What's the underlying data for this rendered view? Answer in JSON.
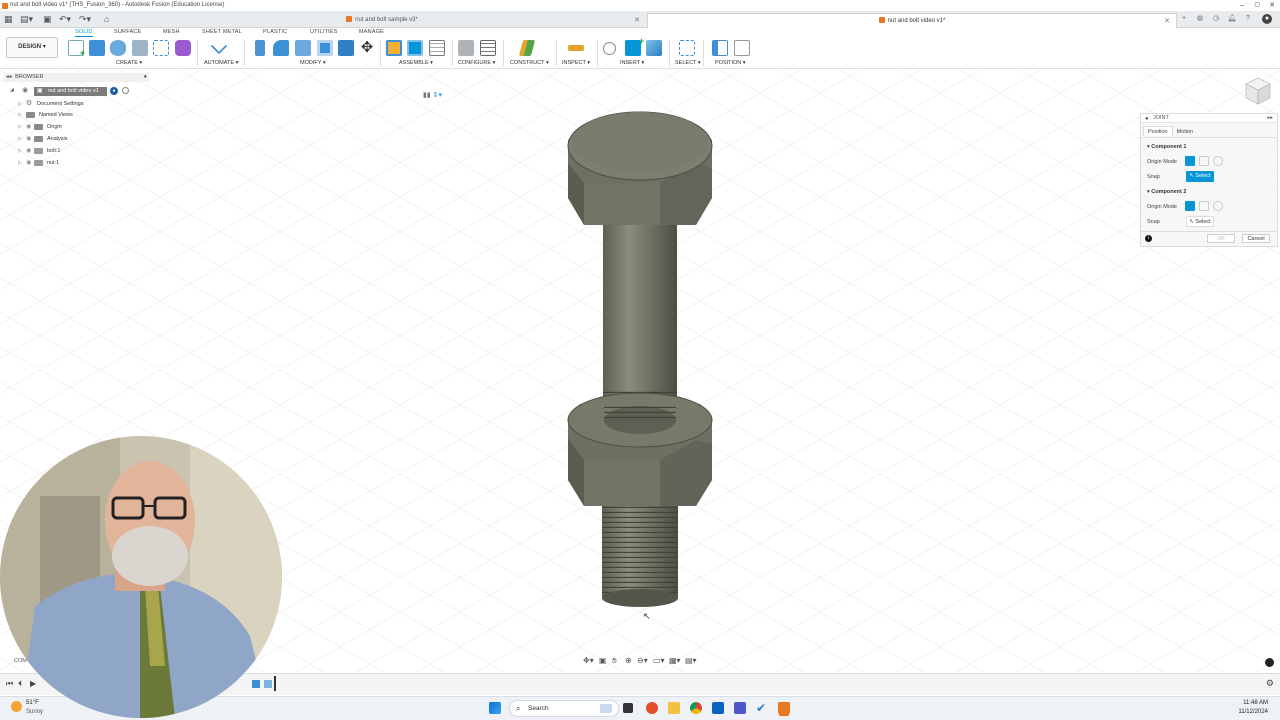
{
  "window": {
    "title": "nut and bolt video v1* (THS_Fusion_360) - Autodesk Fusion (Education License)"
  },
  "doc_tabs": [
    {
      "label": "nut and bolt sample v3*",
      "active": false
    },
    {
      "label": "nut and bolt video v1*",
      "active": true
    }
  ],
  "workspace": {
    "label": "DESIGN"
  },
  "ribbon": {
    "tabs": [
      "SOLID",
      "SURFACE",
      "MESH",
      "SHEET METAL",
      "PLASTIC",
      "UTILITIES",
      "MANAGE"
    ],
    "active_tab": "SOLID",
    "groups": [
      "CREATE",
      "AUTOMATE",
      "MODIFY",
      "ASSEMBLE",
      "CONFIGURE",
      "CONSTRUCT",
      "INSPECT",
      "INSERT",
      "SELECT",
      "POSITION"
    ]
  },
  "browser": {
    "title": "BROWSER",
    "root": "nut and bolt video v1",
    "items": [
      "Document Settings",
      "Named Views",
      "Origin",
      "Analysis",
      "bolt:1",
      "nut:1"
    ]
  },
  "joint_panel": {
    "title": "JOINT",
    "tabs": [
      "Position",
      "Motion"
    ],
    "component1": {
      "heading": "Component 1",
      "origin_mode_label": "Origin Mode",
      "snap_label": "Snap",
      "select_label": "Select"
    },
    "component2": {
      "heading": "Component 2",
      "origin_mode_label": "Origin Mode",
      "snap_label": "Snap",
      "select_label": "Select"
    },
    "ok_label": "OK",
    "cancel_label": "Cancel"
  },
  "comments": {
    "label": "COM"
  },
  "taskbar": {
    "weather_temp": "51°F",
    "weather_desc": "Sunny",
    "search_placeholder": "Search",
    "time": "11:48 AM",
    "date": "11/12/2024"
  },
  "colors": {
    "accent": "#0696d7",
    "bolt": "#6b6c5e",
    "fusion_orange": "#e87722"
  }
}
